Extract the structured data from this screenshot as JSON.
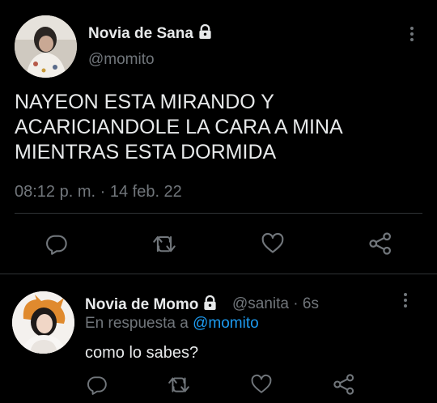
{
  "colors": {
    "background": "#000000",
    "text": "#e7e9ea",
    "muted": "#71767b",
    "link": "#1d9bf0",
    "divider": "#2f3336"
  },
  "main_tweet": {
    "display_name": "Novia de Sana",
    "handle": "@momito",
    "text_lines": [
      "NAYEON ESTA MIRANDO Y",
      "ACARICIANDOLE LA CARA A MINA",
      "MIENTRAS ESTA DORMIDA"
    ],
    "timestamp": "08:12 p. m. · 14 feb. 22",
    "icons": [
      "reply-icon",
      "retweet-icon",
      "like-icon",
      "share-icon"
    ]
  },
  "reply_tweet": {
    "display_name": "Novia de Momo",
    "handle": "@sanita",
    "time": "· 6s",
    "in_reply_prefix": "En respuesta a",
    "in_reply_handle": "@momito",
    "text": "como lo sabes?",
    "icons": [
      "reply-icon",
      "retweet-icon",
      "like-icon",
      "share-icon"
    ]
  }
}
